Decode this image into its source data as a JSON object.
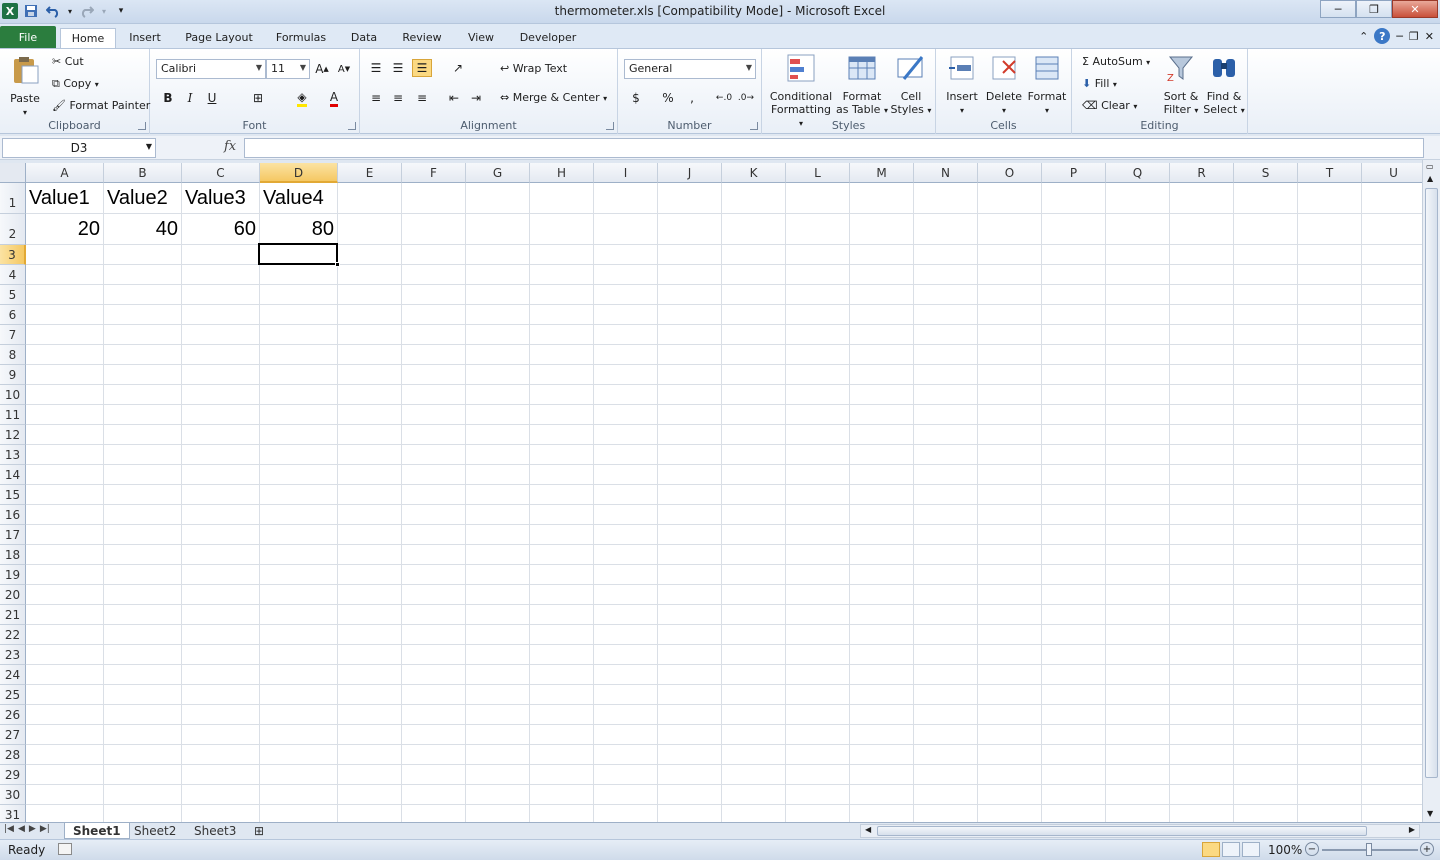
{
  "window": {
    "title": "thermometer.xls  [Compatibility Mode]  -  Microsoft Excel"
  },
  "ribbon_tabs": [
    "File",
    "Home",
    "Insert",
    "Page Layout",
    "Formulas",
    "Data",
    "Review",
    "View",
    "Developer"
  ],
  "active_tab": "Home",
  "clipboard": {
    "paste": "Paste",
    "cut": "Cut",
    "copy": "Copy",
    "format_painter": "Format Painter",
    "label": "Clipboard"
  },
  "font": {
    "name": "Calibri",
    "size": "11",
    "label": "Font"
  },
  "alignment": {
    "wrap": "Wrap Text",
    "merge": "Merge & Center",
    "label": "Alignment"
  },
  "number": {
    "format": "General",
    "label": "Number"
  },
  "styles": {
    "cond": "Conditional",
    "cond2": "Formatting",
    "fmt_table": "Format",
    "fmt_table2": "as Table",
    "cell": "Cell",
    "cell2": "Styles",
    "label": "Styles"
  },
  "cells_group": {
    "insert": "Insert",
    "delete": "Delete",
    "format": "Format",
    "label": "Cells"
  },
  "editing": {
    "autosum": "AutoSum",
    "fill": "Fill",
    "clear": "Clear",
    "sort": "Sort &",
    "sort2": "Filter",
    "find": "Find &",
    "find2": "Select",
    "label": "Editing"
  },
  "formula_bar": {
    "name_box": "D3",
    "fx": "fx",
    "value": ""
  },
  "columns": [
    "A",
    "B",
    "C",
    "D",
    "E",
    "F",
    "G",
    "H",
    "I",
    "J",
    "K",
    "L",
    "M",
    "N",
    "O",
    "P",
    "Q",
    "R",
    "S",
    "T",
    "U"
  ],
  "selected_cell": "D3",
  "sheet": {
    "row1": [
      "Value1",
      "Value2",
      "Value3",
      "Value4"
    ],
    "row2": [
      "20",
      "40",
      "60",
      "80"
    ]
  },
  "rows": [
    "1",
    "2",
    "3",
    "4",
    "5",
    "6",
    "7",
    "8",
    "9",
    "10",
    "11",
    "12",
    "13",
    "14",
    "15",
    "16",
    "17",
    "18",
    "19",
    "20",
    "21",
    "22",
    "23",
    "24",
    "25",
    "26",
    "27",
    "28",
    "29",
    "30",
    "31"
  ],
  "sheet_tabs": [
    "Sheet1",
    "Sheet2",
    "Sheet3"
  ],
  "active_sheet": "Sheet1",
  "status": {
    "ready": "Ready",
    "zoom": "100%"
  }
}
